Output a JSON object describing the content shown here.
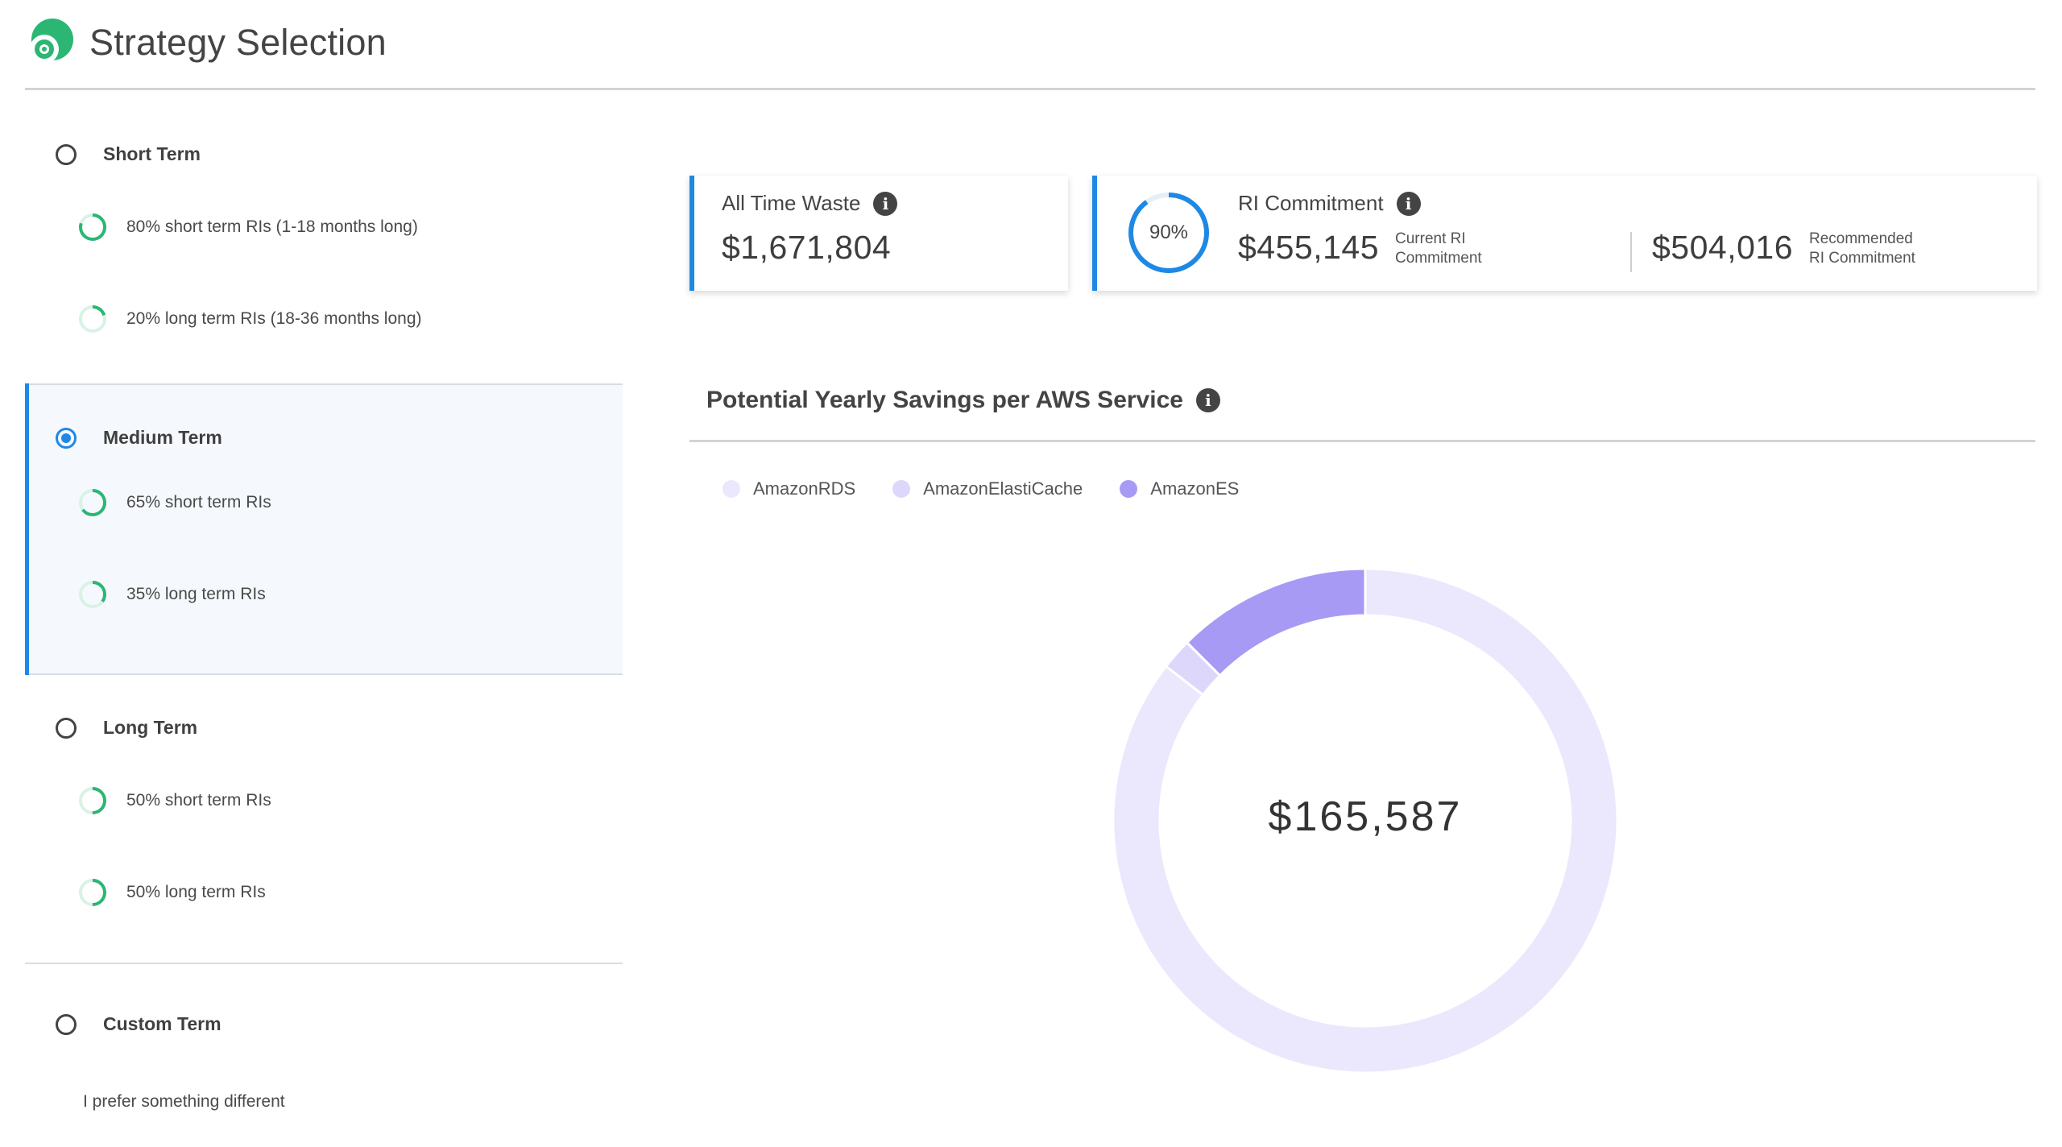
{
  "header": {
    "title": "Strategy Selection",
    "logo_icon": "target-logo-icon",
    "brand_color": "#2bb673"
  },
  "strategies": [
    {
      "title": "Short Term",
      "selected": false,
      "items": [
        {
          "label": "80% short term RIs (1-18 months long)",
          "percent": 0.8
        },
        {
          "label": "20% long term RIs (18-36 months long)",
          "percent": 0.2
        }
      ]
    },
    {
      "title": "Medium Term",
      "selected": true,
      "items": [
        {
          "label": "65% short term RIs",
          "percent": 0.65
        },
        {
          "label": "35% long term RIs",
          "percent": 0.35
        }
      ]
    },
    {
      "title": "Long Term",
      "selected": false,
      "items": [
        {
          "label": "50% short term RIs",
          "percent": 0.5
        },
        {
          "label": "50% long term RIs",
          "percent": 0.5
        }
      ]
    },
    {
      "title": "Custom Term",
      "selected": false,
      "description": "I prefer something different"
    }
  ],
  "waste_card": {
    "label": "All Time Waste",
    "value": "$1,671,804",
    "info_icon": "info-icon"
  },
  "ri_card": {
    "label": "RI Commitment",
    "percent_label": "90%",
    "percent": 0.9,
    "current_value": "$455,145",
    "current_caption_line1": "Current RI",
    "current_caption_line2": "Commitment",
    "recommended_value": "$504,016",
    "recommended_caption_line1": "Recommended",
    "recommended_caption_line2": "RI Commitment",
    "info_icon": "info-icon"
  },
  "savings": {
    "title": "Potential Yearly Savings per AWS Service",
    "info_icon": "info-icon",
    "total": "$165,587"
  },
  "colors": {
    "accent": "#1e88e5",
    "ring_green": "#2bb673",
    "ring_track": "#d9f2e6"
  },
  "chart_data": {
    "type": "pie",
    "donut": true,
    "title": "Potential Yearly Savings per AWS Service",
    "center_label": "$165,587",
    "legend_position": "top-left",
    "series": [
      {
        "name": "AmazonRDS",
        "value": 0.855,
        "color": "#ebe8fd"
      },
      {
        "name": "AmazonElastiCache",
        "value": 0.02,
        "color": "#dcd7fb"
      },
      {
        "name": "AmazonES",
        "value": 0.125,
        "color": "#a79af5"
      }
    ]
  }
}
